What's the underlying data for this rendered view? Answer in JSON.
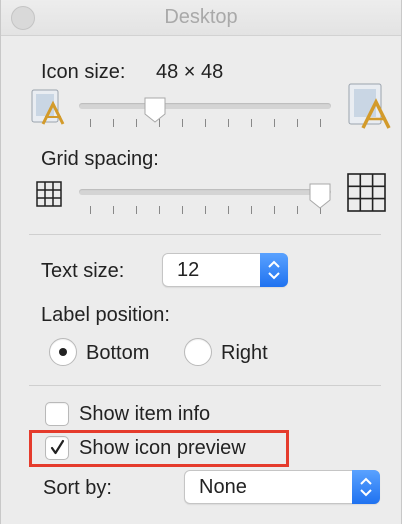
{
  "window": {
    "title": "Desktop"
  },
  "icon_size": {
    "label": "Icon size:",
    "value": "48 × 48",
    "slider_fraction": 0.3
  },
  "grid_spacing": {
    "label": "Grid spacing:",
    "slider_fraction": 1.0
  },
  "text_size": {
    "label": "Text size:",
    "value": "12"
  },
  "label_position": {
    "label": "Label position:",
    "options": [
      {
        "label": "Bottom",
        "selected": true
      },
      {
        "label": "Right",
        "selected": false
      }
    ]
  },
  "checkboxes": [
    {
      "label": "Show item info",
      "checked": false
    },
    {
      "label": "Show icon preview",
      "checked": true
    }
  ],
  "sort_by": {
    "label": "Sort by:",
    "value": "None"
  },
  "colors": {
    "accent": "#1f72f0",
    "highlight": "#e53b2c"
  },
  "icons": [
    "app-small-icon",
    "app-large-icon",
    "grid-small-icon",
    "grid-large-icon",
    "chevron-updown-icon",
    "checkmark-icon"
  ]
}
